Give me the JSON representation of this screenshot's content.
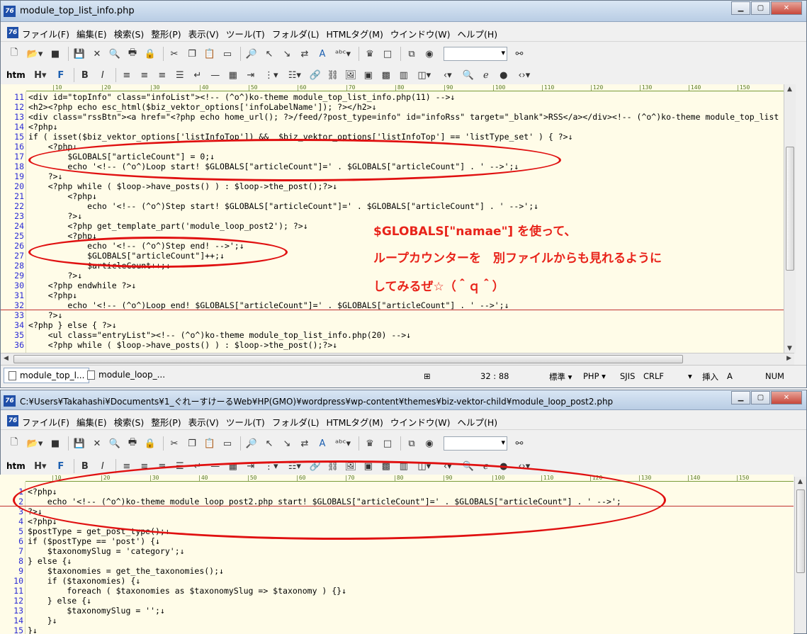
{
  "window1": {
    "title": "module_top_list_info.php",
    "menu": [
      "ファイル(F)",
      "編集(E)",
      "検索(S)",
      "整形(P)",
      "表示(V)",
      "ツール(T)",
      "フォルダ(L)",
      "HTMLタグ(M)",
      "ウインドウ(W)",
      "ヘルプ(H)"
    ],
    "ruler": [
      "10",
      "20",
      "30",
      "40",
      "50",
      "60",
      "70",
      "80",
      "90",
      "100",
      "110",
      "120",
      "130",
      "140",
      "150"
    ],
    "lines": [
      {
        "n": "11",
        "t": "<div id=\"topInfo\" class=\"infoList\"><!-- (^o^)ko-theme module_top_list_info.php(11) -->↓"
      },
      {
        "n": "12",
        "t": "<h2><?php echo esc_html($biz_vektor_options['infoLabelName']); ?></h2>↓"
      },
      {
        "n": "13",
        "t": "<div class=\"rssBtn\"><a href=\"<?php echo home_url(); ?>/feed/?post_type=info\" id=\"infoRss\" target=\"_blank\">RSS</a></div><!-- (^o^)ko-theme module_top_list"
      },
      {
        "n": "14",
        "t": "<?php↓"
      },
      {
        "n": "15",
        "t": "if ( isset($biz_vektor_options['listInfoTop']) &&  $biz_vektor_options['listInfoTop'] == 'listType_set' ) { ?>↓"
      },
      {
        "n": "16",
        "t": "    <?php↓"
      },
      {
        "n": "17",
        "t": "        $GLOBALS[\"articleCount\"] = 0;↓"
      },
      {
        "n": "18",
        "t": "        echo '<!-- (^o^)Loop start! $GLOBALS[\"articleCount\"]=' . $GLOBALS[\"articleCount\"] . ' -->';↓"
      },
      {
        "n": "19",
        "t": "    ?>↓"
      },
      {
        "n": "20",
        "t": "    <?php while ( $loop->have_posts() ) : $loop->the_post();?>↓"
      },
      {
        "n": "21",
        "t": "        <?php↓"
      },
      {
        "n": "22",
        "t": "            echo '<!-- (^o^)Step start! $GLOBALS[\"articleCount\"]=' . $GLOBALS[\"articleCount\"] . ' -->';↓"
      },
      {
        "n": "23",
        "t": "        ?>↓"
      },
      {
        "n": "24",
        "t": "        <?php get_template_part('module_loop_post2'); ?>↓"
      },
      {
        "n": "25",
        "t": "        <?php↓"
      },
      {
        "n": "26",
        "t": "            echo '<!-- (^o^)Step end! -->';↓"
      },
      {
        "n": "27",
        "t": "            $GLOBALS[\"articleCount\"]++;↓"
      },
      {
        "n": "28",
        "t": "            $articleCount++;↓"
      },
      {
        "n": "29",
        "t": "        ?>↓"
      },
      {
        "n": "30",
        "t": "    <?php endwhile ?>↓"
      },
      {
        "n": "31",
        "t": "    <?php↓"
      },
      {
        "n": "32",
        "t": "        echo '<!-- (^o^)Loop end! $GLOBALS[\"articleCount\"]=' . $GLOBALS[\"articleCount\"] . ' -->';↓"
      },
      {
        "n": "33",
        "t": "    ?>↓"
      },
      {
        "n": "34",
        "t": "<?php } else { ?>↓"
      },
      {
        "n": "35",
        "t": "    <ul class=\"entryList\"><!-- (^o^)ko-theme module_top_list_info.php(20) -->↓"
      },
      {
        "n": "36",
        "t": "    <?php while ( $loop->have_posts() ) : $loop->the_post();?>↓"
      }
    ],
    "tabs": [
      "module_top_l...",
      "module_loop_..."
    ],
    "status": {
      "position": "32 : 88",
      "mode": "標準",
      "lang": "PHP",
      "encoding": "SJIS",
      "newline": "CRLF",
      "insert": "挿入",
      "ime": "A",
      "num": "NUM"
    }
  },
  "annotation": {
    "line1": "$GLOBALS[\"namae\"] を使って、",
    "line2": "ループカウンターを　別ファイルからも見れるように",
    "line3": "してみるぜ☆（＾ｑ＾）"
  },
  "window2": {
    "title": "C:¥Users¥Takahashi¥Documents¥1_ぐれーすけーるWeb¥HP(GMO)¥wordpress¥wp-content¥themes¥biz-vektor-child¥module_loop_post2.php",
    "menu": [
      "ファイル(F)",
      "編集(E)",
      "検索(S)",
      "整形(P)",
      "表示(V)",
      "ツール(T)",
      "フォルダ(L)",
      "HTMLタグ(M)",
      "ウインドウ(W)",
      "ヘルプ(H)"
    ],
    "lines": [
      {
        "n": "1",
        "t": "<?php↓"
      },
      {
        "n": "2",
        "t": "    echo '<!-- (^o^)ko-theme module_loop_post2.php start! $GLOBALS[\"articleCount\"]=' . $GLOBALS[\"articleCount\"] . ' -->';"
      },
      {
        "n": "3",
        "t": "?>↓"
      },
      {
        "n": "4",
        "t": "<?php↓"
      },
      {
        "n": "5",
        "t": "$postType = get_post_type();↓"
      },
      {
        "n": "6",
        "t": "if ($postType == 'post') {↓"
      },
      {
        "n": "7",
        "t": "    $taxonomySlug = 'category';↓"
      },
      {
        "n": "8",
        "t": "} else {↓"
      },
      {
        "n": "9",
        "t": "    $taxonomies = get_the_taxonomies();↓"
      },
      {
        "n": "10",
        "t": "    if ($taxonomies) {↓"
      },
      {
        "n": "11",
        "t": "        foreach ( $taxonomies as $taxonomySlug => $taxonomy ) {}↓"
      },
      {
        "n": "12",
        "t": "    } else {↓"
      },
      {
        "n": "13",
        "t": "        $taxonomySlug = '';↓"
      },
      {
        "n": "14",
        "t": "    }↓"
      },
      {
        "n": "15",
        "t": "}↓"
      }
    ]
  },
  "toolbar1": [
    "new-file",
    "open-folder",
    "stop",
    "save",
    "cut-x",
    "print-preview",
    "print",
    "lock",
    "scissors",
    "copy",
    "paste",
    "window",
    "search",
    "search-back",
    "search-next",
    "replace",
    "spell",
    "abc",
    "crown",
    "square",
    "copy-doc",
    "globe"
  ],
  "toolbar2": [
    "htm",
    "H",
    "F",
    "B",
    "I",
    "align-left",
    "align-center",
    "align-right",
    "list",
    "return",
    "hr",
    "table",
    "indent",
    "tree",
    "list2",
    "link",
    "link2",
    "image",
    "image2",
    "color",
    "grid",
    "frame",
    "angle",
    "preview",
    "ie",
    "circle",
    "tag"
  ]
}
